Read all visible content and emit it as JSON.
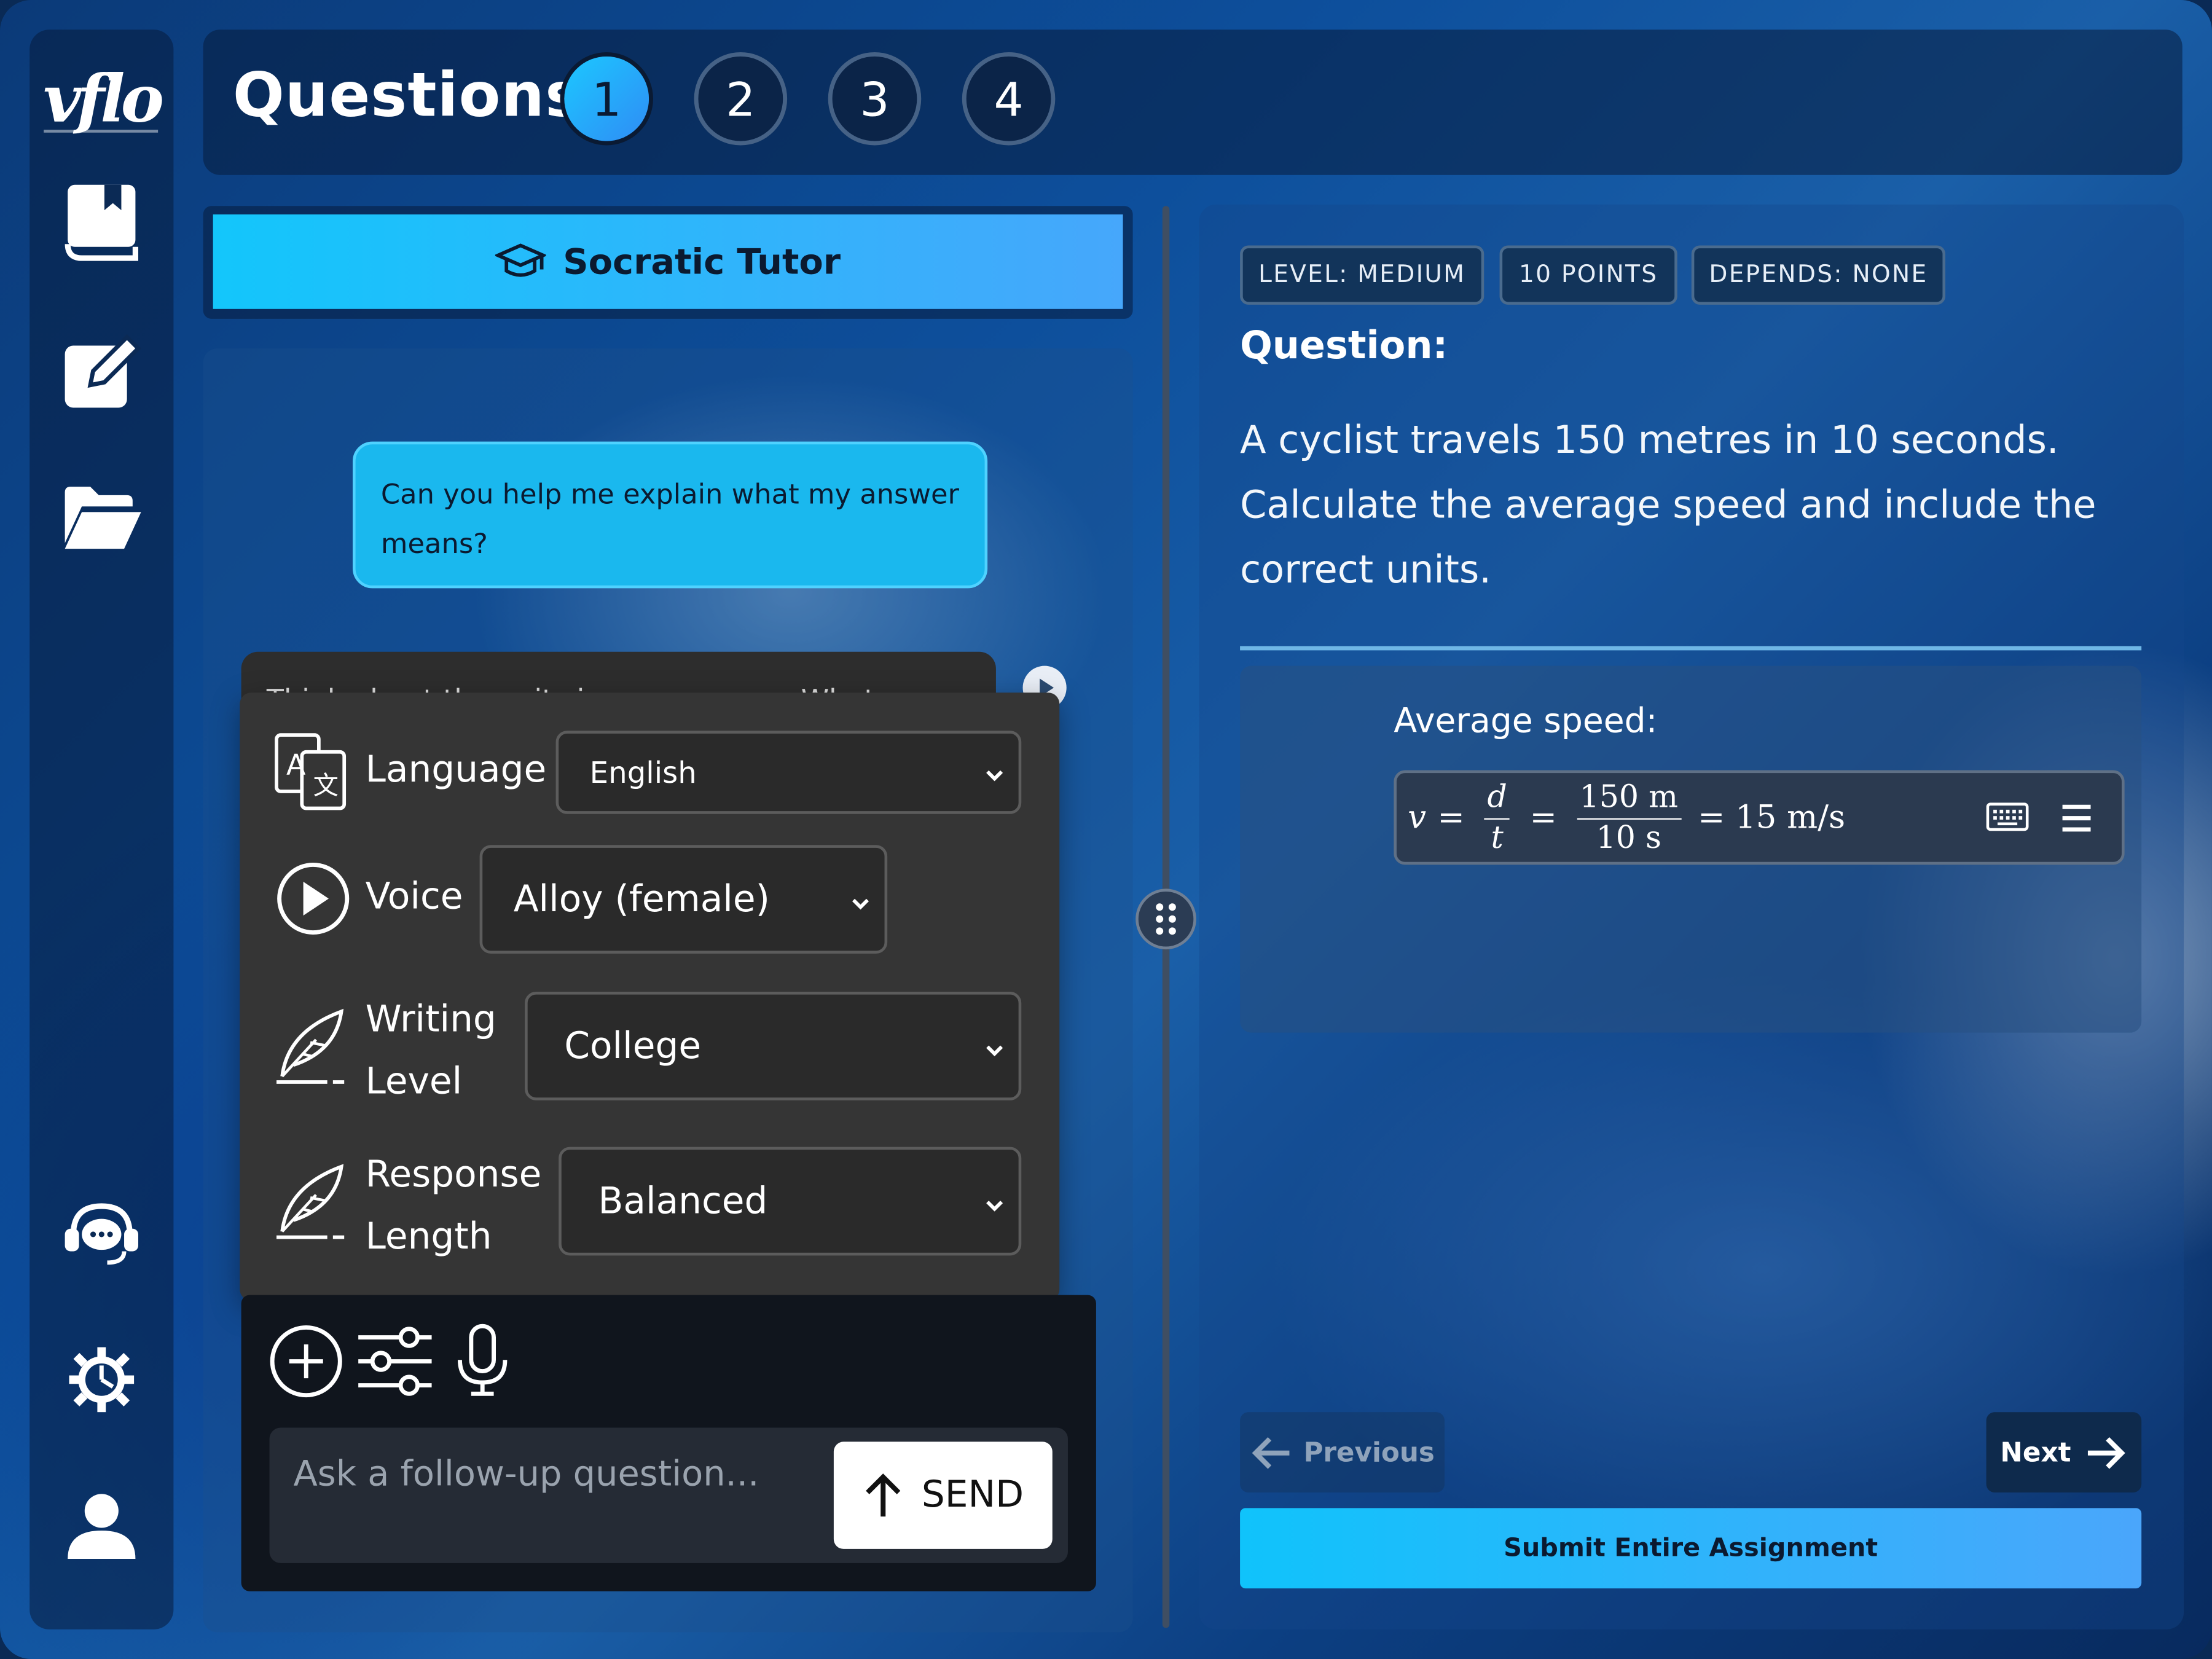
{
  "brand": {
    "logo_text": "vflo"
  },
  "sidebar": {
    "icons": [
      "book-icon",
      "edit-icon",
      "folder-icon",
      "support-chat-icon",
      "settings-gear-icon",
      "user-profile-icon"
    ]
  },
  "header": {
    "title": "Questions",
    "question_numbers": [
      "1",
      "2",
      "3",
      "4"
    ],
    "active_question": "1"
  },
  "tutor": {
    "title": "Socratic Tutor",
    "user_message": "Can you help me explain what my answer means?",
    "ai_message_partial": "Think about the units in your answer. What",
    "settings": {
      "language": {
        "label": "Language",
        "value": "English"
      },
      "voice": {
        "label": "Voice",
        "value": "Alloy (female)"
      },
      "writing_level": {
        "label_line1": "Writing",
        "label_line2": "Level",
        "value": "College"
      },
      "response_length": {
        "label_line1": "Response",
        "label_line2": "Length",
        "value": "Balanced"
      }
    },
    "input_placeholder": "Ask a follow-up question...",
    "send_label": "SEND"
  },
  "question": {
    "tags": {
      "level": "LEVEL: MEDIUM",
      "points": "10 POINTS",
      "depends": "DEPENDS: NONE"
    },
    "label": "Question:",
    "text": "A cyclist travels 150 metres in 10 seconds. Calculate the average speed and include the correct units.",
    "answer_label": "Average speed:",
    "math": {
      "v": "v",
      "eq": "=",
      "d": "d",
      "t": "t",
      "num": "150 m",
      "den": "10 s",
      "result": "= 15 m/s"
    }
  },
  "nav": {
    "previous": "Previous",
    "next": "Next",
    "submit": "Submit Entire Assignment"
  },
  "colors": {
    "accent_cyan": "#13c6fb",
    "accent_blue": "#46a7fb",
    "popup_bg": "#353535"
  }
}
